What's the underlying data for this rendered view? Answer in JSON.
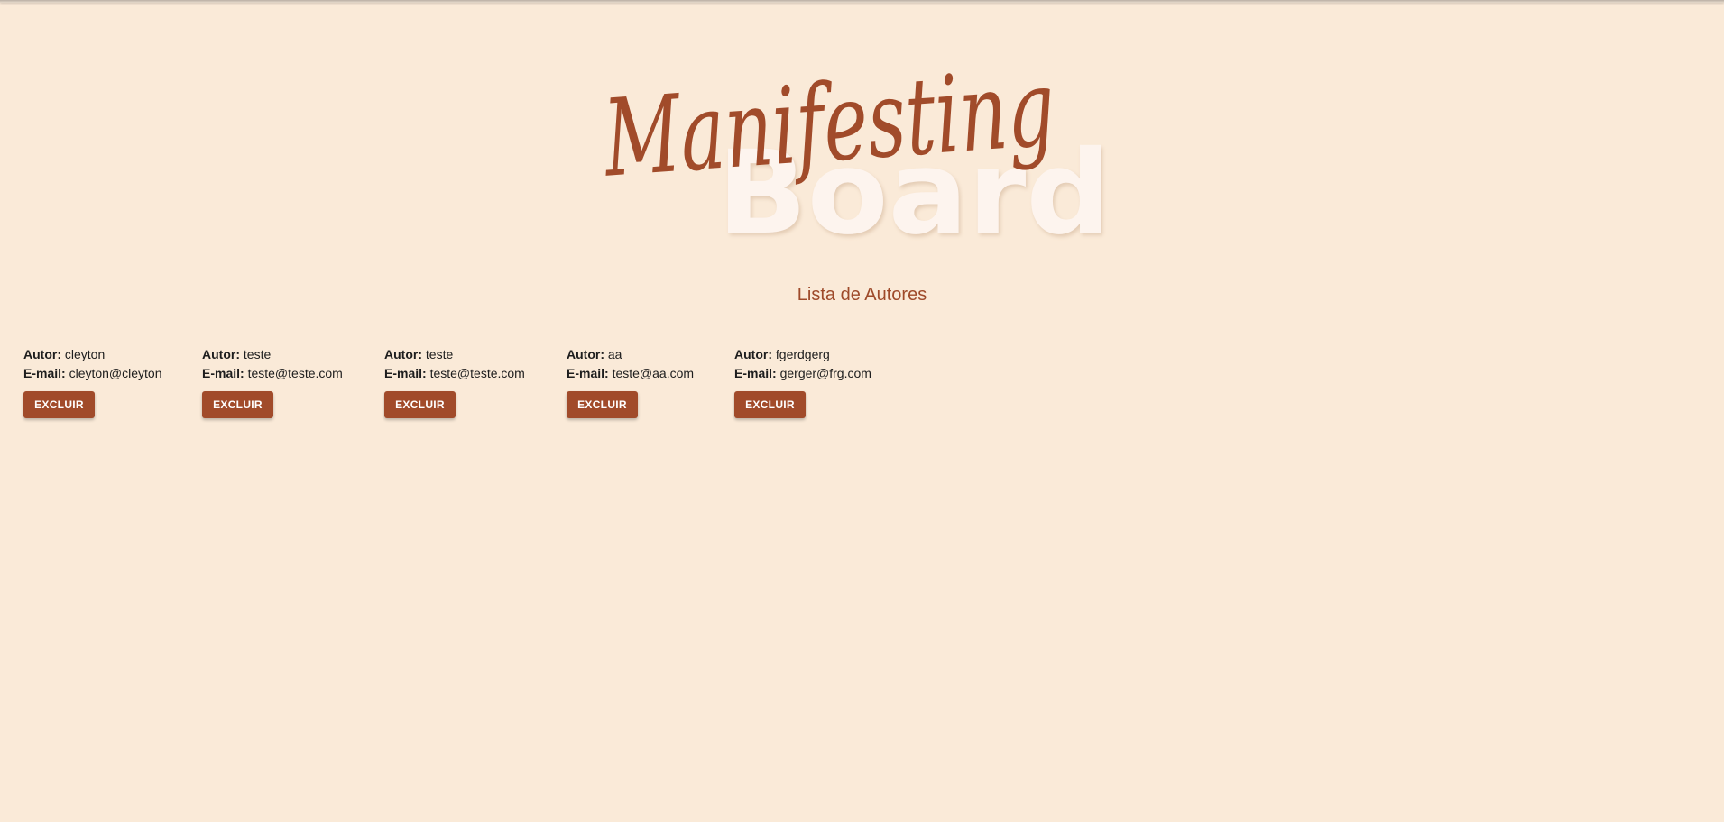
{
  "header": {
    "logo_script": "Manifesting",
    "logo_bold": "Board"
  },
  "page": {
    "title": "Lista de Autores",
    "author_label": "Autor:",
    "email_label": "E-mail:",
    "delete_label": "EXCLUIR"
  },
  "colors": {
    "background": "#faead8",
    "accent": "#a14b2a",
    "logo_bold": "#fdf4ee"
  },
  "authors": [
    {
      "name": "cleyton",
      "email": "cleyton@cleyton"
    },
    {
      "name": "teste",
      "email": "teste@teste.com"
    },
    {
      "name": "teste",
      "email": "teste@teste.com"
    },
    {
      "name": "aa",
      "email": "teste@aa.com"
    },
    {
      "name": "fgerdgerg",
      "email": "gerger@frg.com"
    }
  ]
}
